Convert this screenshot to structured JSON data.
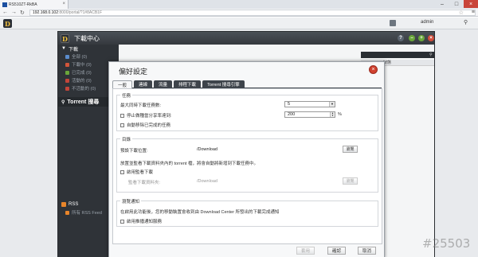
{
  "browser": {
    "tab_title": "RS510ZT-RkBA",
    "url_host": "192.168.0.102",
    "url_path": ":8000/portal/?1#8ACB1F"
  },
  "topbar": {
    "user": "admin"
  },
  "app": {
    "title": "下載中心",
    "sidebar": {
      "download_section": "下載",
      "items": [
        {
          "label": "全部 (0)",
          "color": "#5a8ccc"
        },
        {
          "label": "下載中 (0)",
          "color": "#d2553a"
        },
        {
          "label": "已完成 (0)",
          "color": "#6aa63a"
        },
        {
          "label": "活動的 (0)",
          "color": "#c2453a"
        },
        {
          "label": "不活動的 (0)",
          "color": "#c2453a"
        }
      ],
      "torrent_label": "Torrent 搜尋",
      "rss_section": "RSS",
      "rss_item": "所有 RSS Feed"
    },
    "list_header": "狀態"
  },
  "dialog": {
    "title": "偏好設定",
    "tabs": [
      "一般",
      "連線",
      "流量",
      "排程下載",
      "Torrent 搜尋引擎"
    ],
    "task": {
      "legend": "任務",
      "max_downloads_label": "最大同時下載任務數:",
      "max_downloads_value": "5",
      "seed_limit_label": "停止做種當分享率達到:",
      "seed_limit_value": "200",
      "seed_limit_unit": "%",
      "auto_remove_label": "自動移除已完成的任務"
    },
    "dirs": {
      "legend": "目錄",
      "default_folder_label": "預設下載位置:",
      "default_folder_value": "/Download",
      "browse_label": "瀏覽",
      "watch_desc": "放置並監看下載資料夾內的 torrent 檔，將會自動將新增到下載任務中。",
      "enable_watch_label": "啟用監看下載",
      "watch_folder_label": "監看下載資料夾:",
      "watch_folder_value": "/Download",
      "browse2_label": "瀏覽"
    },
    "notify": {
      "legend": "瀏覽通知",
      "desc": "在啟用此功能後，您的移動裝置會收到由 Download Center 所發出的下載完成通知",
      "enable_label": "啟用推播通知服務"
    },
    "buttons": {
      "apply": "套用",
      "ok": "確認",
      "cancel": "取消"
    }
  },
  "watermark": "#25503"
}
